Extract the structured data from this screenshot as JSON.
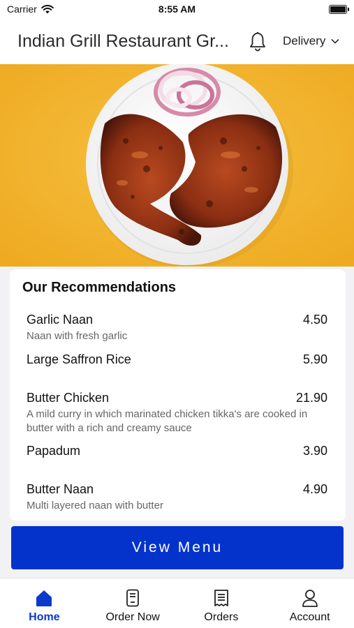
{
  "status_bar": {
    "carrier": "Carrier",
    "time": "8:55 AM"
  },
  "header": {
    "title": "Indian Grill Restaurant Gr...",
    "delivery_label": "Delivery"
  },
  "recommendations": {
    "title": "Our Recommendations",
    "items": [
      {
        "name": "Garlic Naan",
        "price": "4.50",
        "description": "Naan with fresh garlic"
      },
      {
        "name": "Large Saffron Rice",
        "price": "5.90",
        "description": ""
      },
      {
        "name": "Butter Chicken",
        "price": "21.90",
        "description": "A mild curry in which marinated chicken tikka's are cooked in butter with a rich and creamy sauce"
      },
      {
        "name": "Papadum",
        "price": "3.90",
        "description": ""
      },
      {
        "name": "Butter Naan",
        "price": "4.90",
        "description": "Multi layered naan with butter"
      }
    ]
  },
  "view_menu_label": "View Menu",
  "tabs": [
    {
      "label": "Home",
      "icon": "home-icon",
      "active": true
    },
    {
      "label": "Order Now",
      "icon": "order-icon",
      "active": false
    },
    {
      "label": "Orders",
      "icon": "receipt-icon",
      "active": false
    },
    {
      "label": "Account",
      "icon": "user-icon",
      "active": false
    }
  ],
  "colors": {
    "accent": "#0433cc",
    "hero_background": "#f4b630",
    "active_tab": "#0a3acb"
  }
}
